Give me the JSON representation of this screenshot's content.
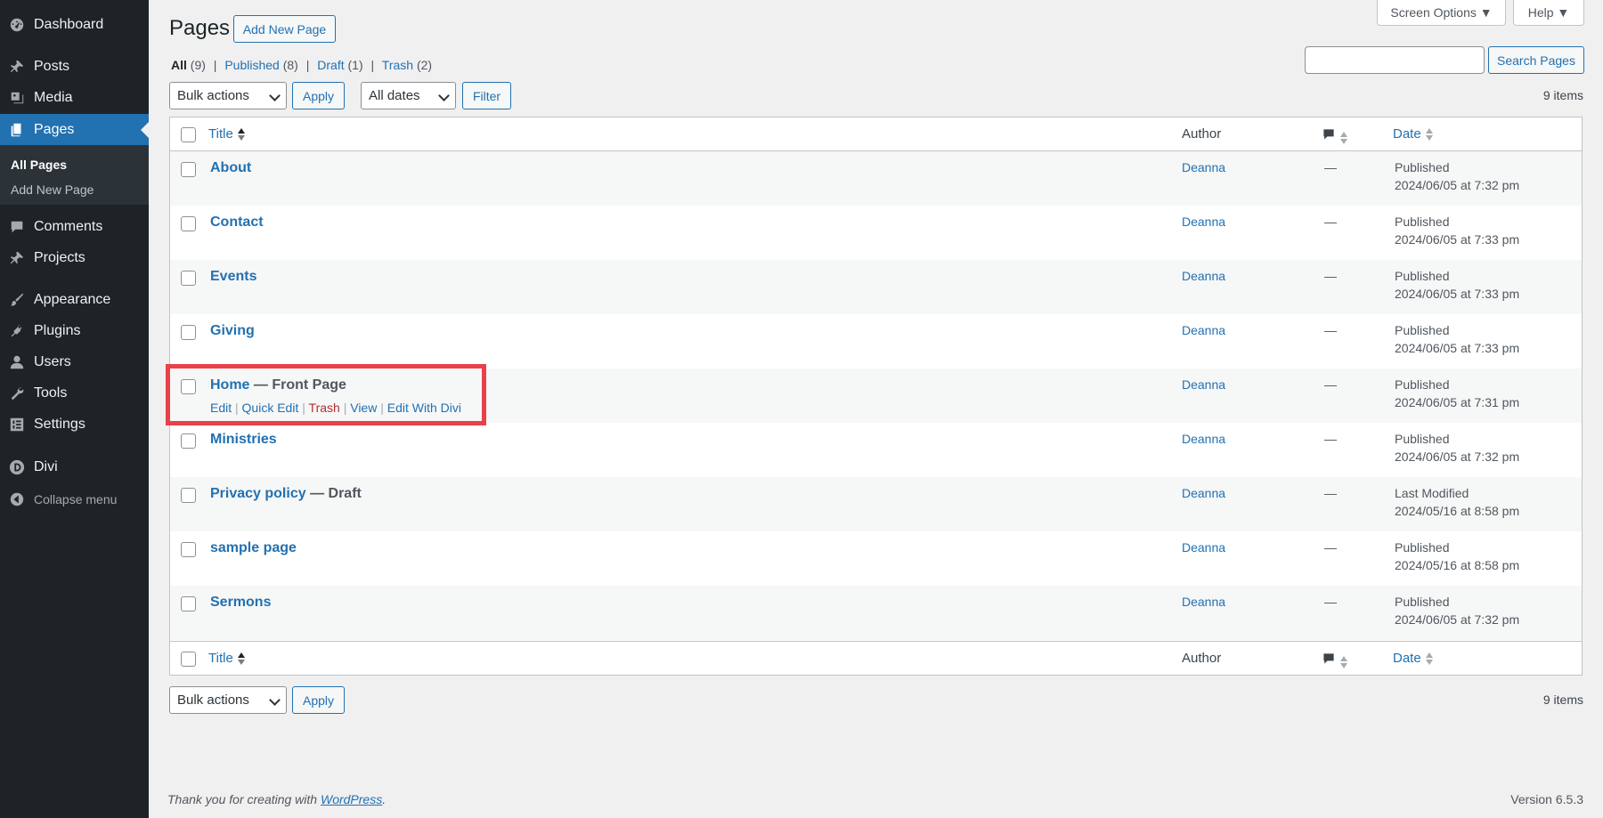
{
  "sidebar": {
    "items": [
      {
        "label": "Dashboard",
        "icon": "dashboard-icon"
      },
      {
        "label": "Posts",
        "icon": "pin-icon"
      },
      {
        "label": "Media",
        "icon": "media-icon"
      },
      {
        "label": "Pages",
        "icon": "page-icon"
      },
      {
        "label": "Comments",
        "icon": "comment-icon"
      },
      {
        "label": "Projects",
        "icon": "pin-icon"
      },
      {
        "label": "Appearance",
        "icon": "brush-icon"
      },
      {
        "label": "Plugins",
        "icon": "plug-icon"
      },
      {
        "label": "Users",
        "icon": "user-icon"
      },
      {
        "label": "Tools",
        "icon": "wrench-icon"
      },
      {
        "label": "Settings",
        "icon": "settings-icon"
      },
      {
        "label": "Divi",
        "icon": "divi-logo-icon"
      }
    ],
    "submenu": {
      "all_pages": "All Pages",
      "add_new": "Add New Page"
    },
    "collapse_label": "Collapse menu"
  },
  "header": {
    "title": "Pages",
    "add_new_label": "Add New Page",
    "screen_options_label": "Screen Options ▼",
    "help_label": "Help ▼"
  },
  "filters": {
    "all_label": "All",
    "all_count": "(9)",
    "published_label": "Published",
    "published_count": "(8)",
    "draft_label": "Draft",
    "draft_count": "(1)",
    "trash_label": "Trash",
    "trash_count": "(2)",
    "separator": "|",
    "search_button": "Search Pages",
    "search_value": "",
    "bulk_actions": "Bulk actions",
    "apply_label": "Apply",
    "dates_label": "All dates",
    "filter_label": "Filter",
    "items_count": "9 items"
  },
  "table": {
    "columns": {
      "title": "Title",
      "author": "Author",
      "date": "Date"
    },
    "rows": [
      {
        "title": "About",
        "state": "",
        "author": "Deanna",
        "comments": "—",
        "status": "Published",
        "date": "2024/06/05 at 7:32 pm"
      },
      {
        "title": "Contact",
        "state": "",
        "author": "Deanna",
        "comments": "—",
        "status": "Published",
        "date": "2024/06/05 at 7:33 pm"
      },
      {
        "title": "Events",
        "state": "",
        "author": "Deanna",
        "comments": "—",
        "status": "Published",
        "date": "2024/06/05 at 7:33 pm"
      },
      {
        "title": "Giving",
        "state": "",
        "author": "Deanna",
        "comments": "—",
        "status": "Published",
        "date": "2024/06/05 at 7:33 pm"
      },
      {
        "title": "Home",
        "state": " — Front Page",
        "author": "Deanna",
        "comments": "—",
        "status": "Published",
        "date": "2024/06/05 at 7:31 pm"
      },
      {
        "title": "Ministries",
        "state": "",
        "author": "Deanna",
        "comments": "—",
        "status": "Published",
        "date": "2024/06/05 at 7:32 pm"
      },
      {
        "title": "Privacy policy",
        "state": " — Draft",
        "author": "Deanna",
        "comments": "—",
        "status": "Last Modified",
        "date": "2024/05/16 at 8:58 pm"
      },
      {
        "title": "sample page",
        "state": "",
        "author": "Deanna",
        "comments": "—",
        "status": "Published",
        "date": "2024/05/16 at 8:58 pm"
      },
      {
        "title": "Sermons",
        "state": "",
        "author": "Deanna",
        "comments": "—",
        "status": "Published",
        "date": "2024/06/05 at 7:32 pm"
      }
    ],
    "row_actions": {
      "edit": "Edit",
      "quick_edit": "Quick Edit",
      "trash": "Trash",
      "view": "View",
      "edit_divi": "Edit With Divi",
      "separator": "|"
    }
  },
  "footer": {
    "thanks_prefix": "Thank you for creating with ",
    "thanks_link": "WordPress",
    "thanks_suffix": ".",
    "version": "Version 6.5.3"
  },
  "colors": {
    "accent": "#2271b1",
    "sidebar_bg": "#1d2327",
    "highlight": "#e8414a",
    "trash": "#b32d2e"
  }
}
